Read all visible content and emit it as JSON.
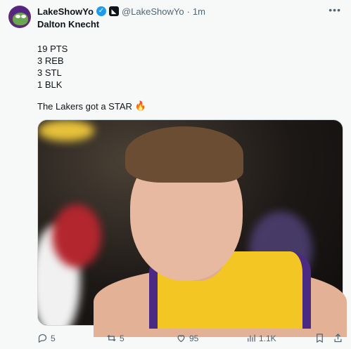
{
  "author": {
    "display_name": "LakeShowYo",
    "handle": "@LakeShowYo",
    "separator": "·",
    "time": "1m",
    "verified_icon": "verified-badge-icon",
    "affiliate_icon": "affiliate-badge-icon"
  },
  "tweet": {
    "title": "Dalton Knecht",
    "stats": [
      "19 PTS",
      "3 REB",
      "3 STL",
      "1 BLK"
    ],
    "tagline": "The Lakers got a STAR",
    "emoji": "🔥"
  },
  "actions": {
    "reply_count": "5",
    "retweet_count": "5",
    "like_count": "95",
    "view_count": "1.1K"
  },
  "colors": {
    "accent": "#1d9bf0",
    "muted_text": "#536471",
    "jersey_gold": "#f3c623",
    "jersey_purple": "#4b2a83"
  }
}
